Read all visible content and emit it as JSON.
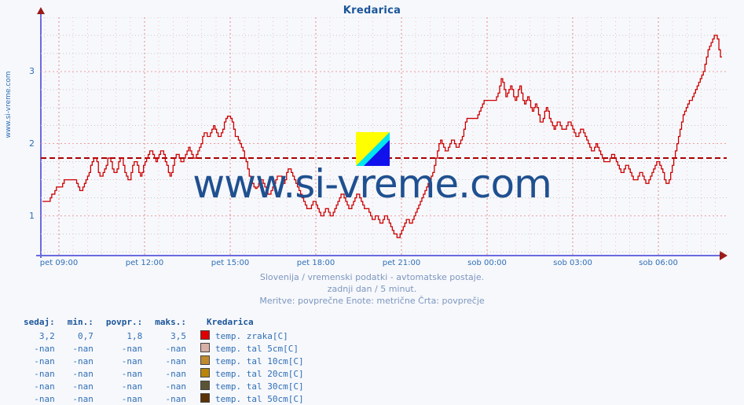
{
  "page": {
    "title": "Kredarica",
    "side_watermark": "www.si-vreme.com",
    "big_watermark": "www.si-vreme.com",
    "logo_name": "si-vreme-logo",
    "logo_colors": {
      "yellow": "#FFFF00",
      "cyan": "#00E5EE",
      "blue": "#1111EE"
    }
  },
  "subtitle": {
    "line1": "Slovenija / vremenski podatki - avtomatske postaje.",
    "line2": "zadnji dan / 5 minut.",
    "line3": "Meritve: povprečne  Enote: metrične  Črta: povprečje"
  },
  "axes": {
    "y_ticks": [
      "1",
      "2",
      "3"
    ],
    "x_ticks": [
      "pet 09:00",
      "pet 12:00",
      "pet 15:00",
      "pet 18:00",
      "pet 21:00",
      "sob 00:00",
      "sob 03:00",
      "sob 06:00"
    ],
    "axis_color": "#6A6AE0",
    "grid_major_color": "#E8A0A0",
    "grid_minor_color": "#C8C8C8"
  },
  "legend": {
    "headers": [
      "sedaj:",
      "min.:",
      "povpr.:",
      "maks.:",
      "Kredarica"
    ],
    "rows": [
      {
        "sedaj": "3,2",
        "min": "0,7",
        "povpr": "1,8",
        "maks": "3,5",
        "color": "#E00000",
        "name": "temp. zraka[C]"
      },
      {
        "sedaj": "-nan",
        "min": "-nan",
        "povpr": "-nan",
        "maks": "-nan",
        "color": "#D8B0A6",
        "name": "temp. tal  5cm[C]"
      },
      {
        "sedaj": "-nan",
        "min": "-nan",
        "povpr": "-nan",
        "maks": "-nan",
        "color": "#C08A2E",
        "name": "temp. tal 10cm[C]"
      },
      {
        "sedaj": "-nan",
        "min": "-nan",
        "povpr": "-nan",
        "maks": "-nan",
        "color": "#B8860B",
        "name": "temp. tal 20cm[C]"
      },
      {
        "sedaj": "-nan",
        "min": "-nan",
        "povpr": "-nan",
        "maks": "-nan",
        "color": "#5A5434",
        "name": "temp. tal 30cm[C]"
      },
      {
        "sedaj": "-nan",
        "min": "-nan",
        "povpr": "-nan",
        "maks": "-nan",
        "color": "#5C3208",
        "name": "temp. tal 50cm[C]"
      }
    ]
  },
  "chart_data": {
    "type": "line",
    "title": "Kredarica",
    "xlabel": "",
    "ylabel": "",
    "series_name": "temp. zraka[C]",
    "line_color": "#CC0000",
    "average_line": {
      "value": 1.8,
      "color": "#AA0000",
      "style": "dashed"
    },
    "ylim": [
      0.45,
      3.75
    ],
    "xlim_labels": [
      "pet 08:35",
      "sob 08:30"
    ],
    "x_tick_times": [
      "pet 09:00",
      "pet 12:00",
      "pet 15:00",
      "pet 18:00",
      "pet 21:00",
      "sob 00:00",
      "sob 03:00",
      "sob 06:00"
    ],
    "stats": {
      "sedaj": 3.2,
      "min": 0.7,
      "povpr": 1.8,
      "maks": 3.5
    },
    "sample_interval_minutes": 5,
    "grid": true,
    "legend_position": "bottom-left",
    "values": [
      1.2,
      1.2,
      1.2,
      1.2,
      1.2,
      1.25,
      1.3,
      1.3,
      1.35,
      1.4,
      1.4,
      1.4,
      1.4,
      1.45,
      1.5,
      1.5,
      1.5,
      1.5,
      1.5,
      1.5,
      1.5,
      1.5,
      1.45,
      1.4,
      1.35,
      1.35,
      1.4,
      1.45,
      1.5,
      1.55,
      1.6,
      1.7,
      1.75,
      1.8,
      1.8,
      1.75,
      1.6,
      1.55,
      1.55,
      1.6,
      1.65,
      1.7,
      1.8,
      1.8,
      1.75,
      1.65,
      1.6,
      1.6,
      1.65,
      1.75,
      1.8,
      1.8,
      1.7,
      1.6,
      1.55,
      1.5,
      1.5,
      1.6,
      1.7,
      1.75,
      1.75,
      1.7,
      1.6,
      1.55,
      1.6,
      1.7,
      1.75,
      1.8,
      1.85,
      1.9,
      1.9,
      1.85,
      1.8,
      1.75,
      1.8,
      1.85,
      1.9,
      1.9,
      1.85,
      1.75,
      1.7,
      1.6,
      1.55,
      1.6,
      1.7,
      1.8,
      1.85,
      1.85,
      1.8,
      1.75,
      1.75,
      1.8,
      1.85,
      1.9,
      1.95,
      1.9,
      1.85,
      1.8,
      1.8,
      1.85,
      1.9,
      1.95,
      2.0,
      2.1,
      2.15,
      2.15,
      2.1,
      2.1,
      2.15,
      2.2,
      2.25,
      2.2,
      2.15,
      2.1,
      2.1,
      2.15,
      2.2,
      2.3,
      2.35,
      2.38,
      2.38,
      2.35,
      2.3,
      2.2,
      2.1,
      2.1,
      2.05,
      2.0,
      1.95,
      1.9,
      1.8,
      1.75,
      1.65,
      1.55,
      1.5,
      1.45,
      1.4,
      1.38,
      1.4,
      1.45,
      1.5,
      1.5,
      1.45,
      1.4,
      1.35,
      1.3,
      1.3,
      1.35,
      1.4,
      1.45,
      1.5,
      1.55,
      1.55,
      1.55,
      1.5,
      1.45,
      1.5,
      1.6,
      1.65,
      1.65,
      1.6,
      1.55,
      1.5,
      1.45,
      1.4,
      1.35,
      1.3,
      1.25,
      1.2,
      1.15,
      1.1,
      1.1,
      1.1,
      1.15,
      1.2,
      1.2,
      1.15,
      1.1,
      1.05,
      1.0,
      1.0,
      1.05,
      1.1,
      1.1,
      1.05,
      1.0,
      1.0,
      1.05,
      1.1,
      1.15,
      1.2,
      1.25,
      1.3,
      1.3,
      1.25,
      1.2,
      1.15,
      1.1,
      1.1,
      1.15,
      1.2,
      1.25,
      1.3,
      1.3,
      1.25,
      1.2,
      1.15,
      1.1,
      1.1,
      1.1,
      1.05,
      1.0,
      0.95,
      0.95,
      1.0,
      1.0,
      0.95,
      0.9,
      0.9,
      0.95,
      1.0,
      1.0,
      0.95,
      0.9,
      0.85,
      0.8,
      0.75,
      0.75,
      0.7,
      0.7,
      0.75,
      0.8,
      0.85,
      0.9,
      0.95,
      0.95,
      0.9,
      0.9,
      0.95,
      1.0,
      1.05,
      1.1,
      1.15,
      1.2,
      1.25,
      1.3,
      1.35,
      1.4,
      1.45,
      1.5,
      1.55,
      1.6,
      1.7,
      1.8,
      1.9,
      2.0,
      2.05,
      2.0,
      1.95,
      1.9,
      1.9,
      1.95,
      2.0,
      2.05,
      2.05,
      2.0,
      1.95,
      1.95,
      2.0,
      2.05,
      2.1,
      2.2,
      2.3,
      2.35,
      2.35,
      2.35,
      2.35,
      2.35,
      2.35,
      2.35,
      2.4,
      2.45,
      2.5,
      2.55,
      2.6,
      2.6,
      2.6,
      2.6,
      2.6,
      2.6,
      2.6,
      2.6,
      2.65,
      2.7,
      2.8,
      2.9,
      2.85,
      2.75,
      2.65,
      2.7,
      2.75,
      2.8,
      2.75,
      2.65,
      2.6,
      2.65,
      2.75,
      2.8,
      2.7,
      2.6,
      2.55,
      2.6,
      2.65,
      2.6,
      2.5,
      2.45,
      2.5,
      2.55,
      2.5,
      2.4,
      2.3,
      2.3,
      2.35,
      2.45,
      2.5,
      2.45,
      2.35,
      2.3,
      2.25,
      2.2,
      2.25,
      2.3,
      2.3,
      2.25,
      2.2,
      2.2,
      2.2,
      2.25,
      2.3,
      2.3,
      2.25,
      2.2,
      2.15,
      2.1,
      2.1,
      2.15,
      2.2,
      2.2,
      2.15,
      2.1,
      2.05,
      2.0,
      1.95,
      1.9,
      1.9,
      1.95,
      2.0,
      1.95,
      1.9,
      1.85,
      1.8,
      1.75,
      1.75,
      1.75,
      1.75,
      1.8,
      1.85,
      1.85,
      1.8,
      1.75,
      1.7,
      1.65,
      1.6,
      1.6,
      1.65,
      1.7,
      1.7,
      1.65,
      1.6,
      1.55,
      1.5,
      1.5,
      1.5,
      1.55,
      1.6,
      1.6,
      1.55,
      1.5,
      1.45,
      1.45,
      1.5,
      1.55,
      1.6,
      1.65,
      1.7,
      1.75,
      1.75,
      1.7,
      1.65,
      1.6,
      1.5,
      1.45,
      1.45,
      1.5,
      1.6,
      1.7,
      1.8,
      1.9,
      2.0,
      2.1,
      2.2,
      2.3,
      2.4,
      2.45,
      2.5,
      2.55,
      2.6,
      2.6,
      2.65,
      2.7,
      2.75,
      2.8,
      2.85,
      2.9,
      2.95,
      3.0,
      3.1,
      3.2,
      3.3,
      3.35,
      3.4,
      3.45,
      3.5,
      3.5,
      3.45,
      3.3,
      3.2,
      3.2
    ]
  }
}
